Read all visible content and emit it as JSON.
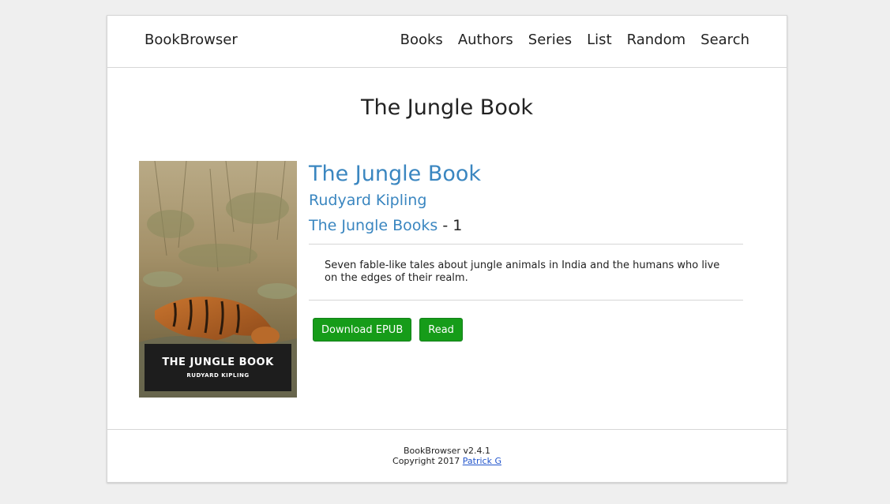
{
  "header": {
    "brand": "BookBrowser",
    "nav": [
      "Books",
      "Authors",
      "Series",
      "List",
      "Random",
      "Search"
    ]
  },
  "page": {
    "title": "The Jungle Book"
  },
  "book": {
    "title": "The Jungle Book",
    "author": "Rudyard Kipling",
    "series_name": "The Jungle Books",
    "series_index": "- 1",
    "description": "Seven fable-like tales about jungle animals in India and the humans who live on the edges of their realm.",
    "cover": {
      "title": "THE JUNGLE BOOK",
      "author": "RUDYARD KIPLING"
    }
  },
  "actions": {
    "download_label": "Download EPUB",
    "read_label": "Read"
  },
  "footer": {
    "version": "BookBrowser v2.4.1",
    "copyright": "Copyright 2017",
    "author_link": "Patrick G"
  },
  "colors": {
    "link": "#3a86c0",
    "button": "#169c19",
    "background": "#efefef"
  }
}
